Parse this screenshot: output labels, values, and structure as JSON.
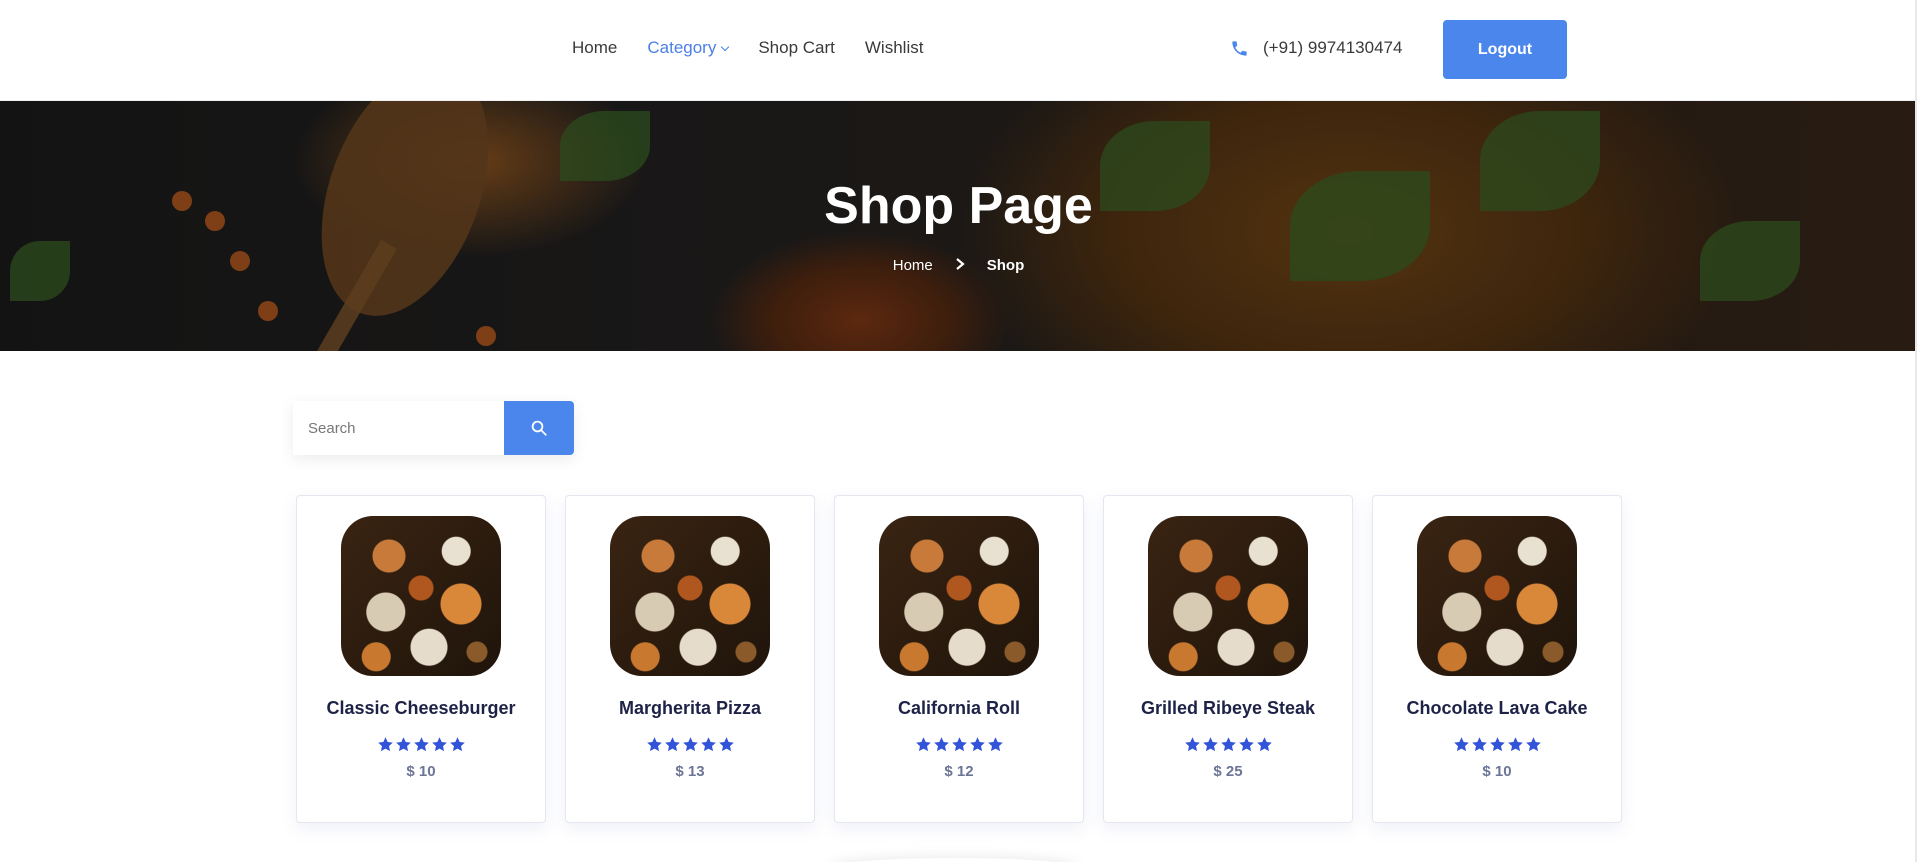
{
  "header": {
    "nav": [
      {
        "label": "Home",
        "active": false
      },
      {
        "label": "Category",
        "active": true,
        "dropdown": true
      },
      {
        "label": "Shop Cart",
        "active": false
      },
      {
        "label": "Wishlist",
        "active": false
      }
    ],
    "phone": "(+91) 9974130474",
    "logout_label": "Logout"
  },
  "hero": {
    "title": "Shop Page",
    "breadcrumb": {
      "home": "Home",
      "current": "Shop"
    }
  },
  "search": {
    "placeholder": "Search",
    "value": ""
  },
  "products": [
    {
      "name": "Classic Cheeseburger",
      "price": "$ 10",
      "rating": 5
    },
    {
      "name": "Margherita Pizza",
      "price": "$ 13",
      "rating": 5
    },
    {
      "name": "California Roll",
      "price": "$ 12",
      "rating": 5
    },
    {
      "name": "Grilled Ribeye Steak",
      "price": "$ 25",
      "rating": 5
    },
    {
      "name": "Chocolate Lava Cake",
      "price": "$ 10",
      "rating": 5
    }
  ],
  "colors": {
    "accent": "#4a86ec",
    "star": "#3354d9",
    "title": "#1e2246",
    "price": "#6c7596"
  },
  "icons": {
    "phone": "phone-icon",
    "search": "search-icon",
    "star": "star-icon",
    "chevron": "chevron-right-icon"
  }
}
